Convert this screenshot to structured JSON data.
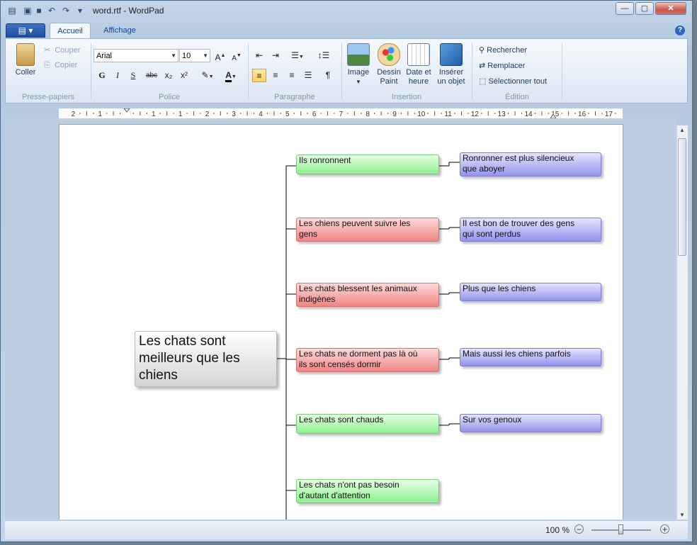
{
  "window": {
    "title": "word.rtf - WordPad",
    "controls": {
      "minimize": "—",
      "maximize": "▢",
      "close": "✕"
    }
  },
  "tabs": [
    {
      "label": "Accueil",
      "active": true
    },
    {
      "label": "Affichage",
      "active": false
    }
  ],
  "ribbon": {
    "clipboard": {
      "paste": "Coller",
      "cut": "Couper",
      "copy": "Copier",
      "group": "Presse-papiers"
    },
    "font": {
      "family": "Arial",
      "size": "10",
      "grow": "A",
      "shrink": "A",
      "bold": "G",
      "italic": "I",
      "underline": "S",
      "strike": "abc",
      "subscript": "x₂",
      "superscript": "x²",
      "color": "A",
      "group": "Police"
    },
    "paragraph": {
      "group": "Paragraphe"
    },
    "insert": {
      "image": "Image",
      "paint1": "Dessin",
      "paint2": "Paint",
      "date1": "Date et",
      "date2": "heure",
      "object1": "Insérer",
      "object2": "un objet",
      "group": "Insertion"
    },
    "editing": {
      "find": "Rechercher",
      "replace": "Remplacer",
      "select_all": "Sélectionner tout",
      "group": "Édition"
    }
  },
  "ruler": {
    "labels": [
      "2",
      "1",
      "1",
      "1",
      "2",
      "3",
      "4",
      "5",
      "6",
      "7",
      "8",
      "9",
      "10",
      "11",
      "12",
      "13",
      "14",
      "15",
      "16",
      "17",
      "18"
    ]
  },
  "mindmap": {
    "central": {
      "line1": "Les chats sont",
      "line2": "meilleurs que les",
      "line3": "chiens"
    },
    "branches": [
      {
        "text1": "Ils ronronnent",
        "text2": "",
        "color": "green",
        "child1": "Ronronner est plus silencieux",
        "child2": "que aboyer"
      },
      {
        "text1": "Les chiens peuvent suivre les",
        "text2": "gens",
        "color": "red",
        "child1": "Il est bon de trouver des gens",
        "child2": "qui sont perdus"
      },
      {
        "text1": "Les chats blessent les animaux",
        "text2": "indigènes",
        "color": "red",
        "child1": "Plus que les chiens",
        "child2": ""
      },
      {
        "text1": "Les chats ne dorment pas là où",
        "text2": "ils sont censés dormir",
        "color": "red",
        "child1": "Mais aussi les chiens parfois",
        "child2": ""
      },
      {
        "text1": "Les chats sont chauds",
        "text2": "",
        "color": "green",
        "child1": "Sur vos genoux",
        "child2": ""
      },
      {
        "text1": "Les chats n'ont pas besoin",
        "text2": "d'autant d'attention",
        "color": "green",
        "child1": "",
        "child2": ""
      }
    ]
  },
  "status": {
    "zoom": "100 %",
    "zoom_out": "−",
    "zoom_in": "+"
  }
}
